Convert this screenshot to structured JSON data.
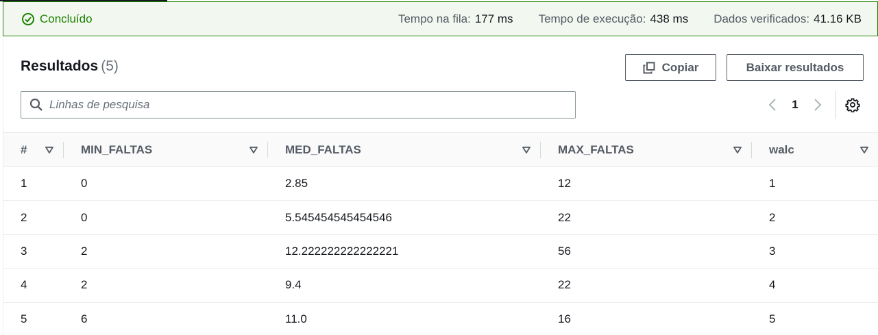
{
  "status": {
    "label": "Concluído",
    "queue_label": "Tempo na fila:",
    "queue_value": "177 ms",
    "exec_label": "Tempo de execução:",
    "exec_value": "438 ms",
    "scanned_label": "Dados verificados:",
    "scanned_value": "41.16 KB",
    "color": "#1d8102"
  },
  "results": {
    "title": "Resultados",
    "count": "(5)",
    "copy_label": "Copiar",
    "download_label": "Baixar resultados",
    "search_placeholder": "Linhas de pesquisa",
    "page": "1"
  },
  "table": {
    "headers": [
      "#",
      "MIN_FALTAS",
      "MED_FALTAS",
      "MAX_FALTAS",
      "walc"
    ],
    "rows": [
      [
        "1",
        "0",
        "2.85",
        "12",
        "1"
      ],
      [
        "2",
        "0",
        "5.545454545454546",
        "22",
        "2"
      ],
      [
        "3",
        "2",
        "12.222222222222221",
        "56",
        "3"
      ],
      [
        "4",
        "2",
        "9.4",
        "22",
        "4"
      ],
      [
        "5",
        "6",
        "11.0",
        "16",
        "5"
      ]
    ]
  }
}
